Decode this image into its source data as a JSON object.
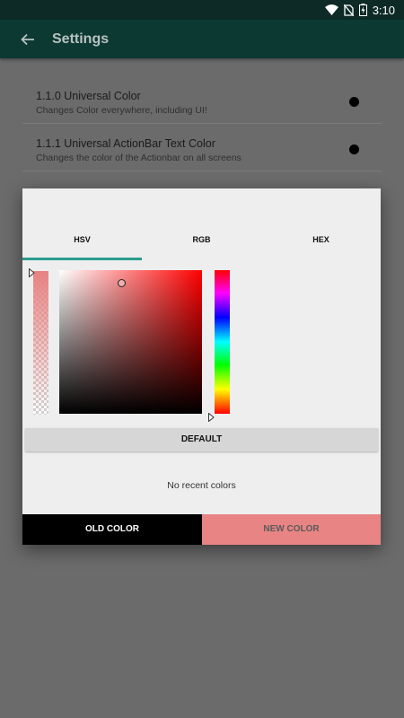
{
  "status_bar": {
    "time": "3:10"
  },
  "app_bar": {
    "title": "Settings"
  },
  "preferences": [
    {
      "title": "1.1.0 Universal Color",
      "summary": "Changes Color everywhere, including UI!"
    },
    {
      "title": "1.1.1 Universal ActionBar Text Color",
      "summary": "Changes the color of the Actionbar on all screens"
    }
  ],
  "dialog": {
    "tabs": [
      {
        "label": "HSV",
        "selected": true
      },
      {
        "label": "RGB",
        "selected": false
      },
      {
        "label": "HEX",
        "selected": false
      }
    ],
    "default_label": "DEFAULT",
    "recent_label": "No recent colors",
    "old_color_label": "OLD COLOR",
    "new_color_label": "NEW COLOR"
  },
  "colors": {
    "old_color": "#000000",
    "new_color": "#e88484",
    "accent": "#2a9d8f",
    "app_bar": "#0c3a33"
  }
}
